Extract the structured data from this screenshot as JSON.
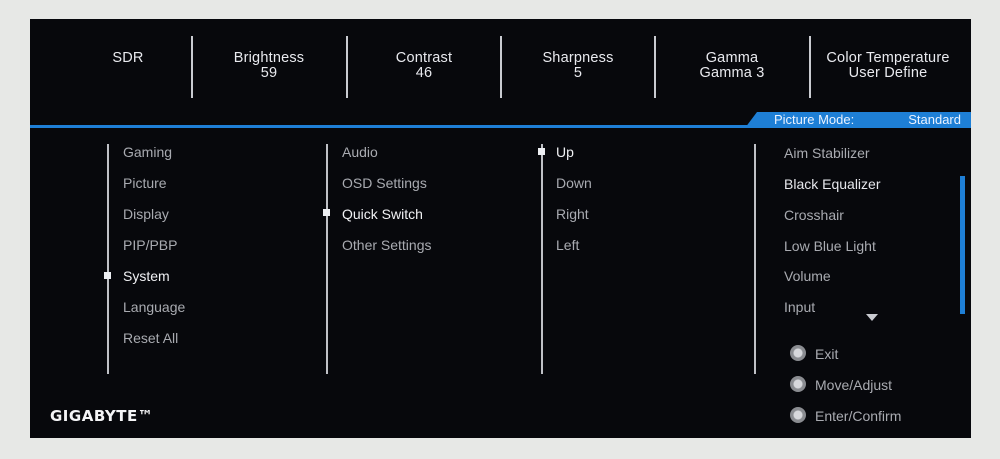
{
  "header": {
    "stats": [
      {
        "label": "SDR",
        "value": ""
      },
      {
        "label": "Brightness",
        "value": "59"
      },
      {
        "label": "Contrast",
        "value": "46"
      },
      {
        "label": "Sharpness",
        "value": "5"
      },
      {
        "label": "Gamma",
        "value": "Gamma 3"
      },
      {
        "label": "Color Temperature",
        "value": "User Define"
      }
    ]
  },
  "picture_mode": {
    "label": "Picture Mode:",
    "value": "Standard"
  },
  "menu": {
    "main": [
      "Gaming",
      "Picture",
      "Display",
      "PIP/PBP",
      "System",
      "Language",
      "Reset All"
    ],
    "main_selected": "System",
    "system": [
      "Audio",
      "OSD Settings",
      "Quick Switch",
      "Other Settings"
    ],
    "system_selected": "Quick Switch",
    "quick_switch": [
      "Up",
      "Down",
      "Right",
      "Left"
    ],
    "quick_switch_selected": "Up",
    "options": [
      "Aim Stabilizer",
      "Black Equalizer",
      "Crosshair",
      "Low Blue Light",
      "Volume",
      "Input"
    ],
    "options_highlighted": "Black Equalizer"
  },
  "controls": [
    {
      "icon": "joystick-icon",
      "label": "Exit"
    },
    {
      "icon": "joystick-icon",
      "label": "Move/Adjust"
    },
    {
      "icon": "joystick-icon",
      "label": "Enter/Confirm"
    }
  ],
  "brand": {
    "logo_text": "GIGABYTE™"
  },
  "colors": {
    "accent": "#1e7fd6",
    "panel": "#07080c"
  }
}
